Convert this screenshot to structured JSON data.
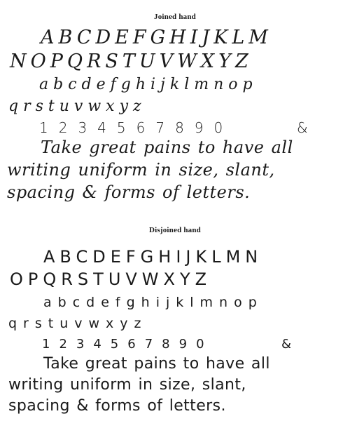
{
  "joined": {
    "title": "Joined hand",
    "caps_line_1": "ABCDEFGHIJKLM",
    "caps_line_2": "NOPQRSTUVWXYZ",
    "lower_line_1": "abcdefghijklmnop",
    "lower_line_2": "qrstuvwxyz",
    "numbers": "1234567890",
    "ampersand": "&",
    "sentence_line_1": "Take great pains to have all",
    "sentence_line_2": "writing uniform in size, slant,",
    "sentence_line_3": "spacing & forms of letters."
  },
  "disjoined": {
    "title": "Disjoined hand",
    "caps_line_1": "ABCDEFGHIJKLMN",
    "caps_line_2": "OPQRSTUVWXYZ",
    "lower_line_1": "abcdefghijklmnop",
    "lower_line_2": "qrstuvwxyz",
    "numbers": "1234567890",
    "ampersand": "&",
    "sentence_line_1": "Take great pains to have all",
    "sentence_line_2": "writing uniform in size, slant,",
    "sentence_line_3": "spacing & forms of letters."
  }
}
